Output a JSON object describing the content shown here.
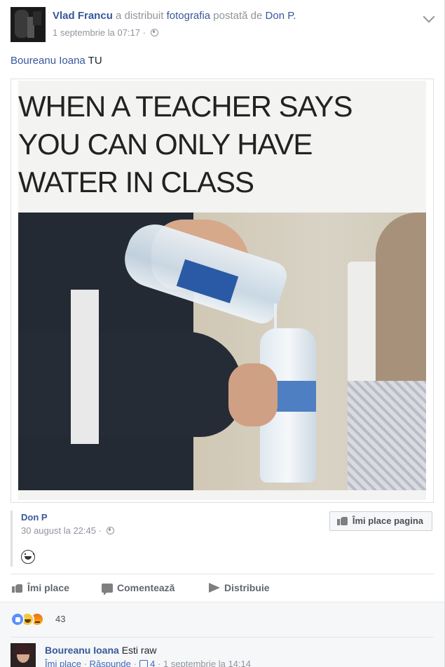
{
  "header": {
    "author": "Vlad Francu",
    "action_text": "a distribuit",
    "object_link": "fotografia",
    "posted_by_text": "postată de",
    "original_author": "Don P.",
    "timestamp": "1 septembrie la 07:17",
    "separator": "·"
  },
  "post": {
    "mention": "Boureanu Ioana",
    "text": "TU"
  },
  "meme": {
    "caption": "WHEN A TEACHER SAYS YOU CAN ONLY HAVE WATER IN CLASS"
  },
  "original_post": {
    "page_name": "Don P",
    "timestamp": "30 august la 22:45",
    "separator": "·",
    "like_page_label": "Îmi place pagina"
  },
  "actions": {
    "like": "Îmi place",
    "comment": "Comentează",
    "share": "Distribuie"
  },
  "reactions": {
    "count": "43",
    "types": [
      "like",
      "haha",
      "angry"
    ],
    "colors": {
      "like": "#5890ff",
      "haha": "#f7c63b",
      "angry": "#e9710f"
    }
  },
  "comment": {
    "author": "Boureanu Ioana",
    "text": "Esti raw",
    "like": "Îmi place",
    "reply": "Răspunde",
    "like_count": "4",
    "timestamp": "1 septembrie la 14:14",
    "separator": "·"
  },
  "colors": {
    "link": "#365899",
    "muted": "#90949c",
    "background": "#ffffff",
    "comments_background": "#f6f7f9"
  }
}
